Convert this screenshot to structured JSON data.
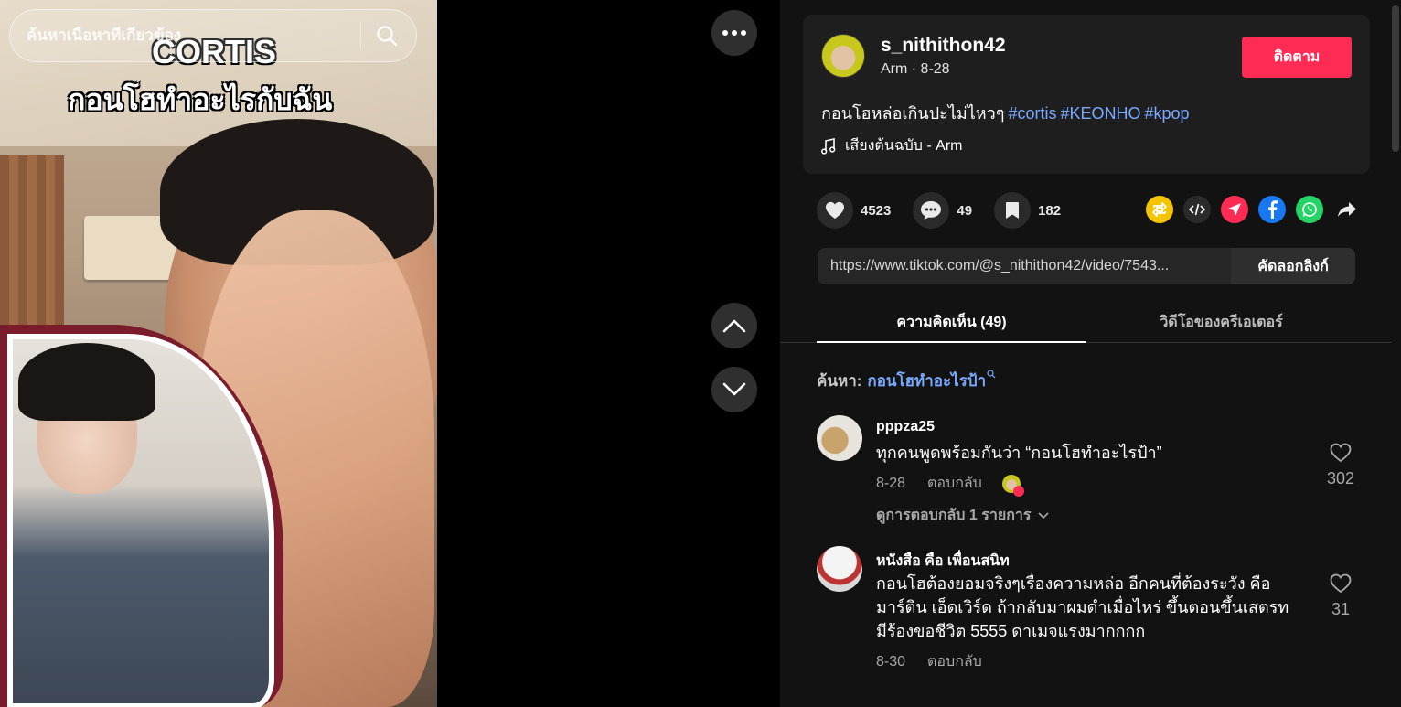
{
  "search": {
    "placeholder": "ค้นหาเนื้อหาที่เกี่ยวข้อง"
  },
  "video": {
    "caption_line1": "CORTIS",
    "caption_line2": "กอนโฮทำอะไรกับฉัน"
  },
  "author": {
    "username": "s_nithithon42",
    "subline": "Arm · 8-28",
    "follow_label": "ติดตาม"
  },
  "post": {
    "description": "กอนโฮหล่อเกินปะไม่ไหวๆ",
    "hashtags": [
      "#cortis",
      "#KEONHO",
      "#kpop"
    ],
    "music": "เสียงต้นฉบับ - Arm"
  },
  "stats": {
    "likes": "4523",
    "comments": "49",
    "saves": "182"
  },
  "share_icons": [
    "repost-icon",
    "embed-icon",
    "send-icon",
    "facebook-icon",
    "whatsapp-icon",
    "share-arrow-icon"
  ],
  "link": {
    "url": "https://www.tiktok.com/@s_nithithon42/video/7543...",
    "copy_label": "คัดลอกลิงก์"
  },
  "tabs": [
    {
      "label": "ความคิดเห็น (49)"
    },
    {
      "label": "วิดีโอของครีเอเตอร์"
    }
  ],
  "search_hint": {
    "label": "ค้นหา:",
    "query": "กอนโฮทำอะไรป้า"
  },
  "comments": [
    {
      "name": "pppza25",
      "text": "ทุกคนพูดพร้อมกันว่า “กอนโฮทำอะไรป้า”",
      "date": "8-28",
      "reply_label": "ตอบกลับ",
      "likes": "302",
      "view_replies": "ดูการตอบกลับ 1 รายการ"
    },
    {
      "name": "หนังสือ คือ เพื่อนสนิท",
      "text_lines": [
        "กอนโฮต้องยอมจริงๆเรื่องความหล่อ อีกคนที่ต้องระวัง คือ",
        "มาร์ติน เอ็ดเวิร์ด ถ้ากลับมาผมดำเมื่อไหร่ ขึ้นตอนขึ้นเสตรท",
        "มีร้องขอชีวิต 5555 ดาเมจแรงมากกกก"
      ],
      "date": "8-30",
      "reply_label": "ตอบกลับ",
      "likes": "31"
    }
  ],
  "colors": {
    "accent": "#fe2c55",
    "link": "#79a9ff",
    "panel": "#121212"
  }
}
